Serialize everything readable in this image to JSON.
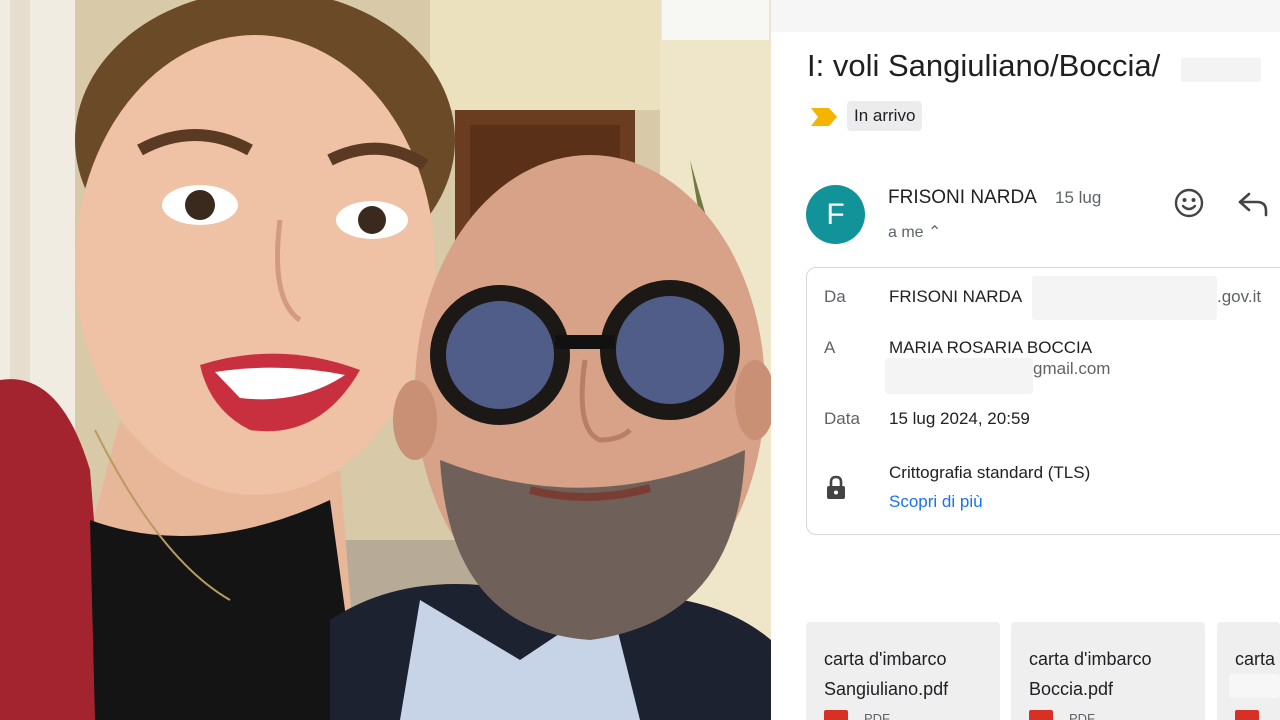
{
  "photo": {
    "description_icon": "selfie-photo"
  },
  "email": {
    "subject": "I: voli Sangiuliano/Boccia/",
    "label": "In arrivo",
    "importance_icon": "importance-marker-icon",
    "avatar_letter": "F",
    "avatar_color": "#12939a",
    "sender": "FRISONI NARDA",
    "date_short": "15 lug",
    "to_me": "a me ⌃",
    "actions": {
      "emoji_icon": "smiley-icon",
      "reply_icon": "reply-icon"
    },
    "details": {
      "from_label": "Da",
      "from_name": "FRISONI NARDA",
      "from_domain": ".gov.it",
      "to_label": "A",
      "to_name": "MARIA ROSARIA BOCCIA",
      "to_domain": "gmail.com",
      "date_label": "Data",
      "date_value": "15 lug 2024, 20:59",
      "security_text": "Crittografia standard (TLS)",
      "learn_more": "Scopri di più",
      "lock_icon": "lock-icon"
    },
    "attachments": [
      {
        "name_line1": "carta d'imbarco",
        "name_line2": "Sangiuliano.pdf",
        "type": "PDF"
      },
      {
        "name_line1": "carta d'imbarco",
        "name_line2": "Boccia.pdf",
        "type": "PDF"
      },
      {
        "name_line1": "carta",
        "name_line2": "",
        "type": ""
      }
    ],
    "colors": {
      "link": "#1a73e8",
      "importance": "#f4b400",
      "pdf": "#d93025"
    }
  }
}
